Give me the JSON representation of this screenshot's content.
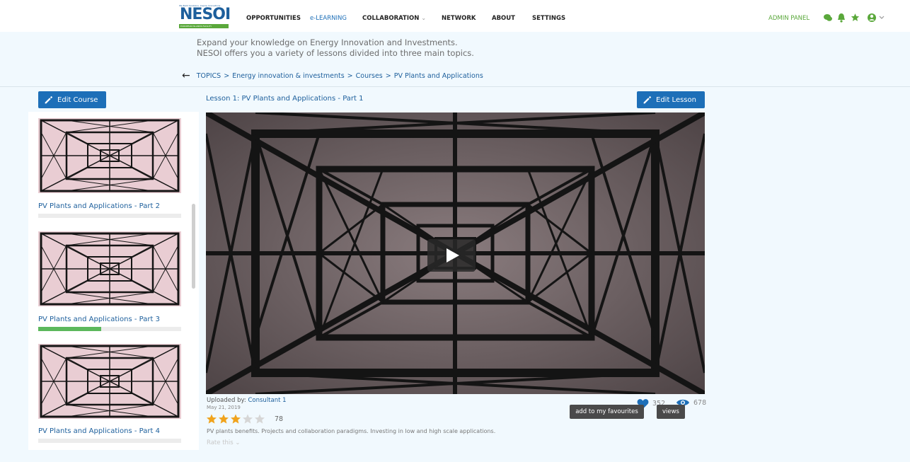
{
  "logo": {
    "tagline": "We Build Solutions, Inspire Innovations",
    "wordmark": "NESOI",
    "subtitle": "EUROPEAN ISLANDS FACILITY"
  },
  "nav": {
    "items": [
      {
        "label": "OPPORTUNITIES"
      },
      {
        "label": "e-LEARNING",
        "active": true
      },
      {
        "label": "COLLABORATION"
      },
      {
        "label": "NETWORK"
      },
      {
        "label": "ABOUT"
      },
      {
        "label": "SETTINGS"
      }
    ],
    "admin_panel": "ADMIN PANEL",
    "icons": [
      "chat-icon",
      "bell-icon",
      "star-icon",
      "user-icon"
    ],
    "accent": "#5aa83b"
  },
  "intro": {
    "line1": "Expand your knowledge on Energy Innovation and Investments.",
    "line2": "NESOI offers you a variety of lessons divided into three main topics."
  },
  "breadcrumb": [
    "TOPICS",
    "Energy innovation & investments",
    "Courses",
    "PV Plants and Applications"
  ],
  "buttons": {
    "edit_course": "Edit Course",
    "edit_lesson": "Edit Lesson"
  },
  "sidebar": {
    "lessons": [
      {
        "title": "PV Plants and Applications - Part 2",
        "progress": 0
      },
      {
        "title": "PV Plants and Applications - Part 3",
        "progress": 0.44
      },
      {
        "title": "PV Plants and Applications - Part 4",
        "progress": 0
      }
    ]
  },
  "lesson": {
    "title": "Lesson 1: PV Plants and Applications - Part 1",
    "uploaded_by_label": "Uploaded by:",
    "uploader": "Consultant 1",
    "date": "May 21, 2019",
    "rating": 3,
    "rating_max": 5,
    "rating_count": "78",
    "description": "PV plants benefits. Projects and collaboration paradigms. Investing in low and high scale applications.",
    "rate_label": "Rate this",
    "favourites_count": "352",
    "views_count": "678",
    "favourites_tooltip": "add to my favourites",
    "views_tooltip": "views"
  },
  "colors": {
    "primary": "#1d6fb8",
    "link": "#1d5f9c",
    "progress": "#5cb85c",
    "star": "#f0a31d",
    "background": "#f1f9fe"
  }
}
